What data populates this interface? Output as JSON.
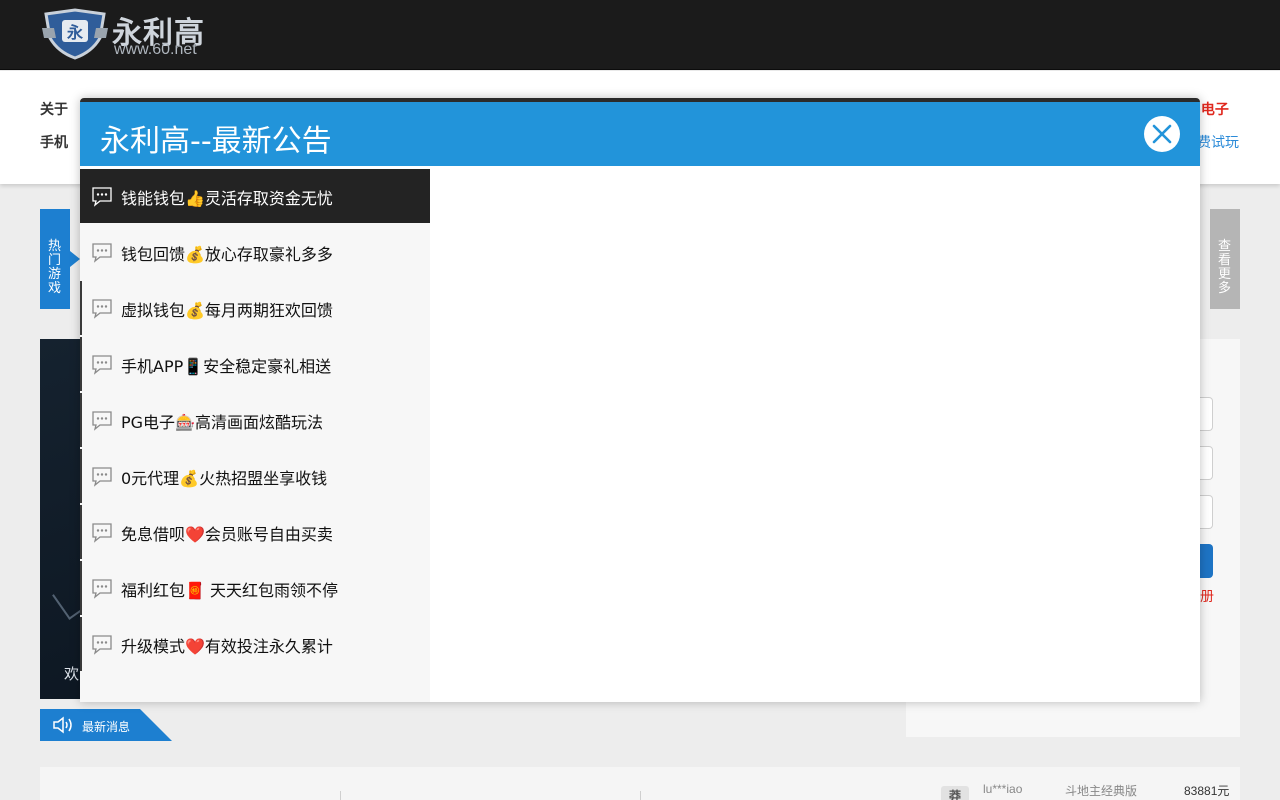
{
  "header": {
    "logo_title": "永利高",
    "logo_url": "www.60.net"
  },
  "nav": {
    "row1_left": "关于",
    "row2_left": "手机",
    "row1_right": "G电子",
    "row2_right": "费试玩"
  },
  "background": {
    "side_tab_left": "热门游戏",
    "side_tab_right": "查看更多",
    "banner_welcome": "欢",
    "login_register": "册",
    "news_label": "最新消息",
    "winner": {
      "avatar": "莽",
      "name": "lu***iao",
      "game": "斗地主经典版",
      "amount": "83881元"
    }
  },
  "modal": {
    "title": "永利高--最新公告",
    "close_icon": "close-icon",
    "items": [
      {
        "label": "钱能钱包👍灵活存取资金无忧",
        "active": true
      },
      {
        "label": "钱包回馈💰放心存取豪礼多多",
        "active": false
      },
      {
        "label": "虚拟钱包💰每月两期狂欢回馈",
        "active": false
      },
      {
        "label": "手机APP📱安全稳定豪礼相送",
        "active": false
      },
      {
        "label": "PG电子🎰高清画面炫酷玩法",
        "active": false
      },
      {
        "label": "0元代理💰火热招盟坐享收钱",
        "active": false
      },
      {
        "label": "免息借呗❤️会员账号自由买卖",
        "active": false
      },
      {
        "label": "福利红包🧧 天天红包雨领不停",
        "active": false
      },
      {
        "label": "升级模式❤️有效投注永久累计",
        "active": false
      }
    ]
  },
  "colors": {
    "header_bg": "#1b1b1b",
    "modal_header": "#2294da",
    "active_item": "#232323",
    "accent_red": "#e0281e",
    "accent_blue": "#1d7fd0"
  }
}
